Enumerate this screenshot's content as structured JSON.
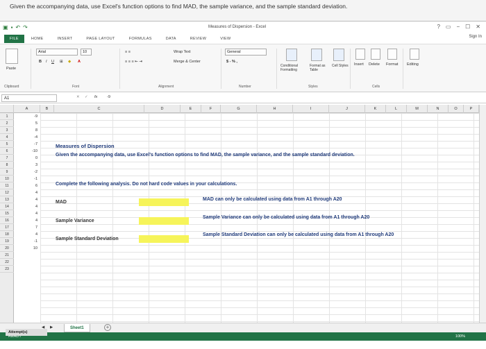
{
  "question": "Given the accompanying data, use Excel's function options to find MAD, the sample variance, and the sample standard deviation.",
  "window": {
    "title": "Measures of Dispersion - Excel",
    "sign_in": "Sign In",
    "controls": [
      "?",
      "▭",
      "−",
      "☐",
      "✕"
    ]
  },
  "ribbon_tabs": [
    "FILE",
    "HOME",
    "INSERT",
    "PAGE LAYOUT",
    "FORMULAS",
    "DATA",
    "REVIEW",
    "VIEW"
  ],
  "ribbon": {
    "font_name": "Arial",
    "font_size": "10",
    "wrap_text": "Wrap Text",
    "merge_center": "Merge & Center",
    "number_format": "General",
    "currency": "$ - % ,",
    "conditional_formatting": "Conditional Formatting",
    "format_as_table": "Format as Table",
    "cell_styles": "Cell Styles",
    "insert": "Insert",
    "delete": "Delete",
    "format": "Format",
    "editing": "Editing",
    "paste": "Paste",
    "groups": {
      "clipboard": "Clipboard",
      "font": "Font",
      "alignment": "Alignment",
      "number": "Number",
      "styles": "Styles",
      "cells": "Cells"
    }
  },
  "formula_bar": {
    "name_box": "A1",
    "value": "-9",
    "fx": "fx"
  },
  "columns": [
    "A",
    "B",
    "C",
    "D",
    "E",
    "F",
    "G",
    "H",
    "I",
    "J",
    "K",
    "L",
    "M",
    "N",
    "O",
    "P"
  ],
  "rows": [
    "1",
    "2",
    "3",
    "4",
    "5",
    "6",
    "7",
    "8",
    "9",
    "10",
    "11",
    "12",
    "13",
    "14",
    "15",
    "16",
    "17",
    "18",
    "19",
    "20",
    "21",
    "22",
    "23"
  ],
  "col_a_values": [
    "-9",
    "5",
    "8",
    "-4",
    "-7",
    "-10",
    "0",
    "3",
    "-2",
    "-1",
    "6",
    "4",
    "4",
    "4",
    "4",
    "4",
    "7",
    "4",
    "-1",
    "10",
    "",
    "",
    ""
  ],
  "cells": {
    "title": "Measures of Dispersion",
    "instructions": "Given the accompanying data, use Excel's function options to find MAD, the sample variance, and the sample standard deviation.",
    "complete": "Complete the following analysis. Do not hard code values in your calculations.",
    "mad_label": "MAD",
    "variance_label": "Sample Variance",
    "stdev_label": "Sample Standard Deviation",
    "mad_note": "MAD can only be calculated using data from A1 through A20",
    "variance_note": "Sample Variance can only be calculated using data from A1 through A20",
    "stdev_note": "Sample Standard Deviation can only be calculated using data from A1 through A20"
  },
  "sheet_tab": "Sheet1",
  "status": {
    "ready": "READY",
    "zoom": "100%"
  },
  "attempts_label": "Attempt(s)"
}
